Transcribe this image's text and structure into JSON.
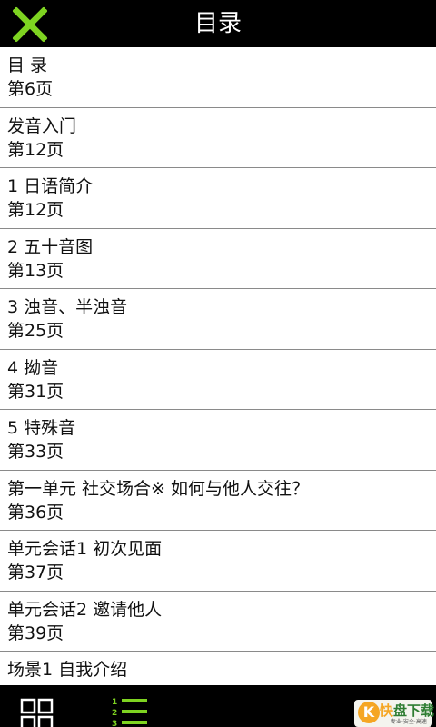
{
  "header": {
    "title": "目录",
    "close_icon": "close-x-icon",
    "accent": "#7ed321"
  },
  "toc": [
    {
      "title": "目 录",
      "page": "第6页"
    },
    {
      "title": "发音入门",
      "page": "第12页"
    },
    {
      "title": "1 日语简介",
      "page": "第12页"
    },
    {
      "title": "2 五十音图",
      "page": "第13页"
    },
    {
      "title": "3 浊音、半浊音",
      "page": "第25页"
    },
    {
      "title": "4 拗音",
      "page": "第31页"
    },
    {
      "title": "5 特殊音",
      "page": "第33页"
    },
    {
      "title": "第一单元 社交场合※ 如何与他人交往？",
      "page": "第36页"
    },
    {
      "title": "单元会话1  初次见面",
      "page": "第37页"
    },
    {
      "title": "单元会话2  邀请他人",
      "page": "第39页"
    },
    {
      "title": "场景1  自我介绍",
      "page": ""
    }
  ],
  "footer": {
    "grid_icon": "grid-view-icon",
    "list_icon": "numbered-list-icon",
    "list_numbers": [
      "1",
      "2",
      "3"
    ],
    "watermark": {
      "kuai": "快",
      "rest": "盘下载",
      "sub": "专业·安全·高速"
    }
  }
}
